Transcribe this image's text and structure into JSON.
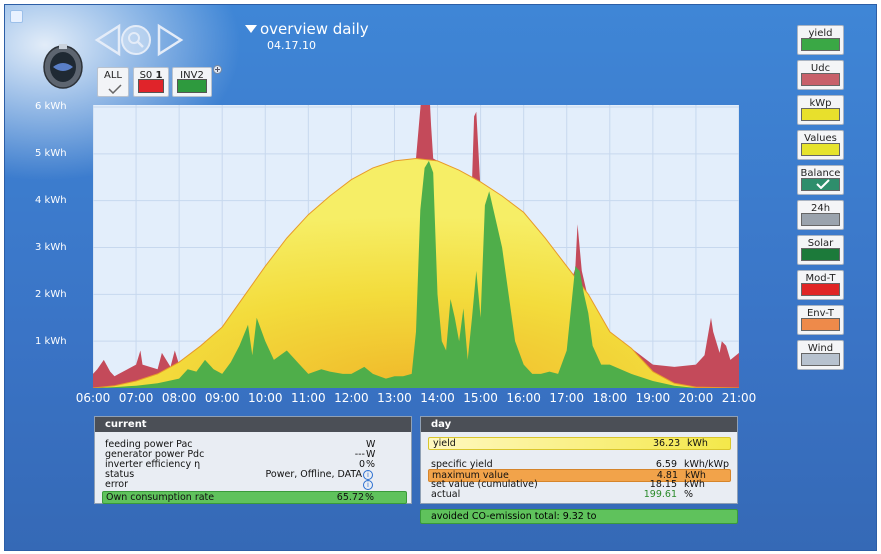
{
  "header": {
    "title": "overview daily",
    "date": "04.17.10"
  },
  "sources": [
    {
      "label": "ALL",
      "swatch": "check"
    },
    {
      "label": "S0",
      "suffix": "1",
      "swatch": "#e0242a"
    },
    {
      "label": "INV2",
      "swatch": "#2e9a3e"
    }
  ],
  "right_menu": [
    {
      "label": "yield",
      "color": "#3aa845"
    },
    {
      "label": "Udc",
      "color": "#c8606a"
    },
    {
      "label": "kWp",
      "color": "#e8e02c"
    },
    {
      "label": "Values",
      "color": "#e6e32c"
    },
    {
      "label": "Balance",
      "color": "#2e8e6c",
      "checked": true
    },
    {
      "label": "24h",
      "color": "#9aa3ad"
    },
    {
      "label": "Solar",
      "color": "#1c7a3a"
    },
    {
      "label": "Mod-T",
      "color": "#e02525"
    },
    {
      "label": "Env-T",
      "color": "#ee8a4a"
    },
    {
      "label": "Wind",
      "color": "#b7c2cf"
    }
  ],
  "chart_data": {
    "type": "area",
    "title": "",
    "x_ticks": [
      "06:00",
      "07:00",
      "08:00",
      "09:00",
      "10:00",
      "11:00",
      "12:00",
      "13:00",
      "14:00",
      "15:00",
      "16:00",
      "17:00",
      "18:00",
      "19:00",
      "20:00",
      "21:00"
    ],
    "y_ticks": [
      "1 kWh",
      "2 kWh",
      "3 kWh",
      "4 kWh",
      "5 kWh",
      "6 kWh"
    ],
    "ylim": [
      0,
      6
    ],
    "xlim": [
      6,
      21
    ],
    "series": [
      {
        "color": "#c44a5a",
        "x": [
          6.0,
          6.1,
          6.25,
          6.4,
          6.5,
          6.6,
          7.0,
          7.1,
          7.15,
          7.5,
          7.6,
          7.8,
          7.9,
          8.0,
          8.2,
          8.5,
          9.0,
          9.5,
          10.0,
          11.0,
          12.0,
          13.0,
          13.5,
          13.65,
          13.75,
          13.85,
          13.9,
          14.0,
          14.5,
          14.8,
          14.85,
          14.9,
          15.0,
          15.5,
          16.0,
          16.5,
          17.0,
          17.2,
          17.25,
          17.35,
          17.5,
          18.0,
          18.5,
          19.0,
          19.5,
          20.0,
          20.2,
          20.35,
          20.4,
          20.55,
          20.6,
          20.7,
          20.8,
          21.0
        ],
        "y": [
          0.3,
          0.4,
          0.6,
          0.35,
          0.25,
          0.3,
          0.5,
          0.8,
          0.5,
          0.4,
          0.75,
          0.45,
          0.8,
          0.5,
          0.5,
          0.85,
          1.3,
          1.95,
          2.6,
          3.7,
          4.45,
          4.85,
          4.9,
          6.5,
          7.4,
          5.6,
          4.9,
          4.85,
          4.65,
          4.4,
          5.8,
          5.9,
          4.2,
          3.75,
          3.2,
          2.65,
          2.0,
          2.55,
          3.5,
          2.5,
          1.9,
          1.2,
          0.85,
          0.5,
          0.45,
          0.5,
          0.7,
          1.5,
          1.2,
          0.75,
          1.0,
          0.9,
          0.6,
          0.75
        ]
      },
      {
        "color": "#f2dd3a",
        "x": [
          6.0,
          6.5,
          7.0,
          7.5,
          8.0,
          8.5,
          9.0,
          9.5,
          10.0,
          10.5,
          11.0,
          11.5,
          12.0,
          12.5,
          13.0,
          13.5,
          14.0,
          14.5,
          15.0,
          15.5,
          16.0,
          16.5,
          17.0,
          17.5,
          18.0,
          18.5,
          19.0,
          19.5,
          20.0,
          21.0
        ],
        "y": [
          0.0,
          0.05,
          0.15,
          0.3,
          0.55,
          0.9,
          1.3,
          1.95,
          2.6,
          3.2,
          3.7,
          4.1,
          4.45,
          4.7,
          4.85,
          4.9,
          4.85,
          4.65,
          4.4,
          4.1,
          3.75,
          3.2,
          2.6,
          2.0,
          1.2,
          0.85,
          0.35,
          0.1,
          0.02,
          0.0
        ]
      },
      {
        "color": "#4fae4a",
        "x": [
          6.0,
          6.5,
          7.0,
          7.5,
          8.0,
          8.2,
          8.4,
          8.6,
          8.8,
          9.0,
          9.2,
          9.4,
          9.6,
          9.7,
          9.8,
          10.0,
          10.2,
          10.5,
          10.8,
          11.0,
          11.3,
          11.5,
          11.8,
          12.0,
          12.3,
          12.5,
          12.8,
          13.0,
          13.2,
          13.4,
          13.5,
          13.6,
          13.7,
          13.8,
          13.9,
          14.0,
          14.1,
          14.2,
          14.3,
          14.4,
          14.5,
          14.6,
          14.7,
          14.8,
          14.9,
          15.0,
          15.1,
          15.2,
          15.3,
          15.5,
          15.8,
          16.0,
          16.2,
          16.4,
          16.6,
          16.8,
          17.0,
          17.2,
          17.3,
          17.4,
          17.5,
          17.6,
          17.8,
          18.0,
          18.5,
          19.0,
          19.5,
          20.0
        ],
        "y": [
          0.0,
          0.02,
          0.05,
          0.1,
          0.2,
          0.4,
          0.35,
          0.6,
          0.4,
          0.3,
          0.55,
          0.9,
          1.35,
          0.7,
          1.5,
          1.0,
          0.6,
          0.8,
          0.5,
          0.3,
          0.4,
          0.35,
          0.3,
          0.3,
          0.45,
          0.3,
          0.2,
          0.25,
          0.25,
          0.3,
          1.2,
          3.8,
          4.7,
          4.85,
          4.6,
          2.0,
          1.0,
          0.8,
          1.9,
          1.5,
          1.0,
          1.7,
          0.6,
          1.5,
          2.5,
          1.5,
          3.9,
          4.2,
          3.8,
          3.0,
          1.0,
          0.5,
          0.3,
          0.3,
          0.35,
          0.3,
          0.8,
          2.6,
          2.5,
          2.0,
          1.6,
          0.9,
          0.5,
          0.5,
          0.3,
          0.15,
          0.05,
          0.0
        ]
      }
    ]
  },
  "current_panel": {
    "title": "current",
    "rows": [
      {
        "label": "feeding power Pac",
        "value": "",
        "unit": "W"
      },
      {
        "label": "generator power Pdc",
        "value": "---",
        "unit": "W"
      },
      {
        "label": "inverter efficiency η",
        "value": "0",
        "unit": "%"
      },
      {
        "label": "status",
        "value": "Power, Offline, DATA",
        "unit": "",
        "info": true
      },
      {
        "label": "error",
        "value": "",
        "unit": "",
        "info": true
      },
      {
        "label": "Own consumption rate",
        "value": "65.72",
        "unit": "%"
      }
    ]
  },
  "day_panel": {
    "title": "day",
    "yield_label": "yield",
    "yield_value": "36.23",
    "yield_unit": "kWh",
    "rows": [
      {
        "label": "specific yield",
        "value": "6.59",
        "unit": "kWh/kWp"
      },
      {
        "label": "maximum value",
        "value": "4.81",
        "unit": "kWh"
      },
      {
        "label": "set value (cumulative)",
        "value": "18.15",
        "unit": "kWh"
      },
      {
        "label": "actual",
        "value": "199.61",
        "unit": "%"
      }
    ],
    "emission": "avoided CO-emission total: 9.32 to"
  }
}
